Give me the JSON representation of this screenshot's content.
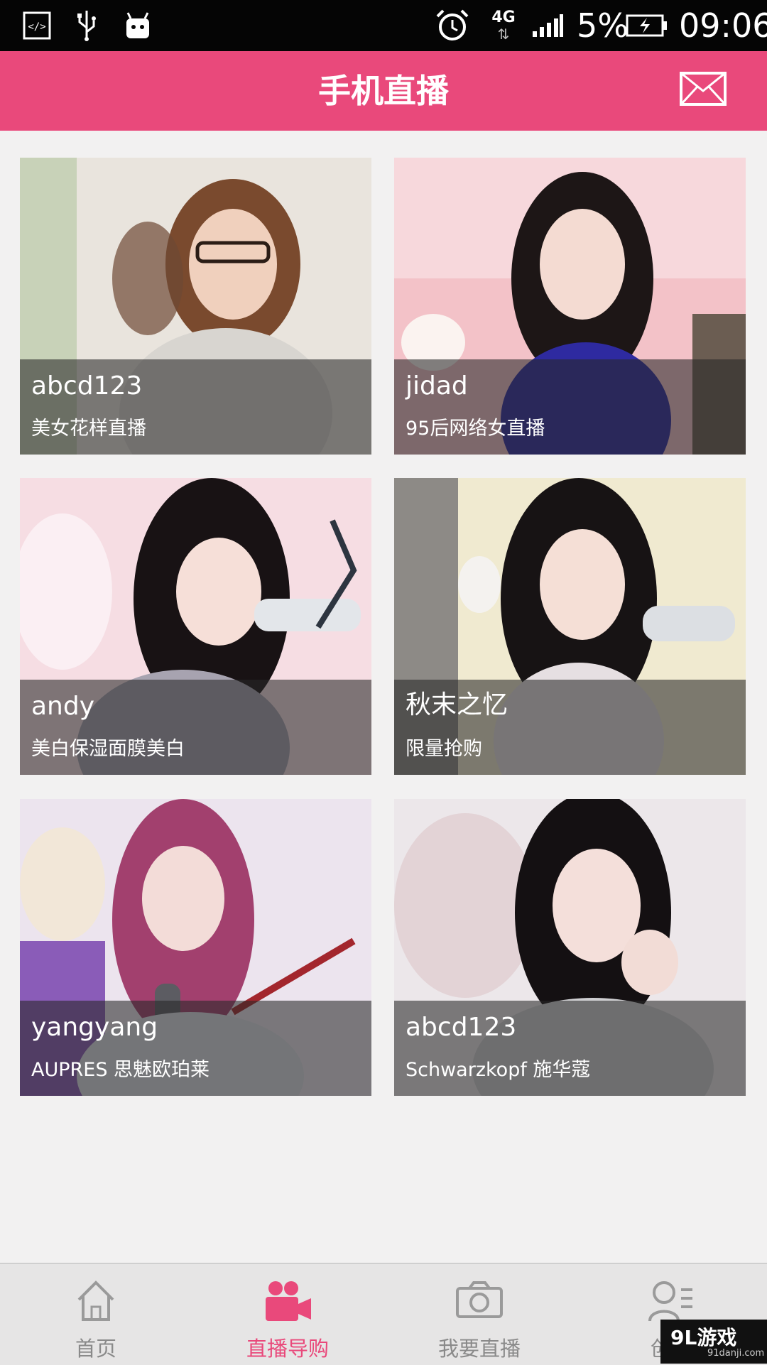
{
  "status_bar": {
    "icons": [
      "developer-mode-icon",
      "usb-icon",
      "android-icon",
      "alarm-icon",
      "network-4g-icon",
      "signal-icon",
      "battery-charging-icon"
    ],
    "network_type": "4G",
    "battery": "5%",
    "time": "09:06"
  },
  "header": {
    "title": "手机直播",
    "action_icon": "mail-icon"
  },
  "streams": [
    {
      "name": "abcd123",
      "desc": "美女花样直播"
    },
    {
      "name": "jidad",
      "desc": "95后网络女直播"
    },
    {
      "name": "andy",
      "desc": "美白保湿面膜美白"
    },
    {
      "name": "秋末之忆",
      "desc": "限量抢购"
    },
    {
      "name": "yangyang",
      "desc": "AUPRES 思魅欧珀莱"
    },
    {
      "name": "abcd123",
      "desc": "Schwarzkopf 施华蔻"
    }
  ],
  "tabs": [
    {
      "label": "首页",
      "icon": "home-icon",
      "active": false
    },
    {
      "label": "直播导购",
      "icon": "video-camera-icon",
      "active": true
    },
    {
      "label": "我要直播",
      "icon": "camera-icon",
      "active": false
    },
    {
      "label": "创客",
      "icon": "profile-card-icon",
      "active": false
    }
  ],
  "colors": {
    "accent": "#e9497b",
    "status_bar": "#050505",
    "background": "#f2f1f1",
    "tab_inactive": "#8a8a8a"
  },
  "watermark": {
    "brand": "9L游戏",
    "domain": "91danji.com"
  }
}
